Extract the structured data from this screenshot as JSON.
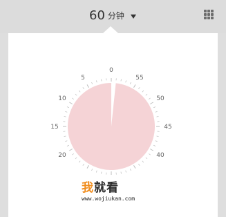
{
  "header": {
    "duration_value": "60",
    "duration_unit": "分钟",
    "caret_icon": "caret-down-icon",
    "menu_icon": "grid-menu-icon"
  },
  "timer": {
    "remaining_minutes": 59,
    "total_minutes": 60,
    "fill_color": "#f5d3d6",
    "tick_color": "#bdbdbd",
    "label_color": "#666666",
    "minute_labels": [
      "0",
      "5",
      "10",
      "15",
      "20",
      "40",
      "45",
      "50",
      "55"
    ]
  },
  "watermark": {
    "logo_first": "我",
    "logo_rest": "就看",
    "url": "www.wojiukan.com",
    "accent_color": "#f08c1c"
  }
}
